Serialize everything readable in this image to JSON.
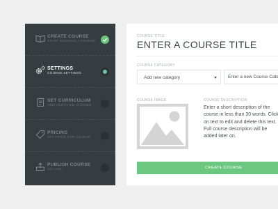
{
  "sidebar": {
    "steps": [
      {
        "title": "CREATE COURSE",
        "subtitle": "START BUILDING A COURSE",
        "icon": "book-icon",
        "state": "done"
      },
      {
        "title": "SETTINGS",
        "subtitle": "COURSE SETTINGS",
        "icon": "gears-icon",
        "state": "current"
      },
      {
        "title": "SET CURRICULUM",
        "subtitle": "ADD UNITS AND QUIZZES",
        "icon": "document-icon",
        "state": "pending"
      },
      {
        "title": "PRICING",
        "subtitle": "SET PRICE FOR COURSE",
        "icon": "price-tag-icon",
        "state": "pending"
      },
      {
        "title": "PUBLISH COURSE",
        "subtitle": "GO LIVE !",
        "icon": "upload-icon",
        "state": "pending"
      }
    ]
  },
  "main": {
    "course_title_label": "COURSE TITLE",
    "course_title_value": "ENTER A COURSE TITLE",
    "category_label": "COURSE CATEGORY",
    "category_selected": "Add new category",
    "new_category_placeholder": "Enter a new Course Category",
    "image_label": "COURSE IMAGE",
    "description_label": "COURSE DESCRIPTION",
    "description_text": "Enter a short description of the course in less than 30 words. Click on text to edit and delete this text. Full course description will be added later on.",
    "create_button_label": "CREATE COURSE"
  },
  "colors": {
    "sidebar_bg": "#363d41",
    "accent_green": "#6cc77f",
    "page_bg": "#efefef"
  }
}
